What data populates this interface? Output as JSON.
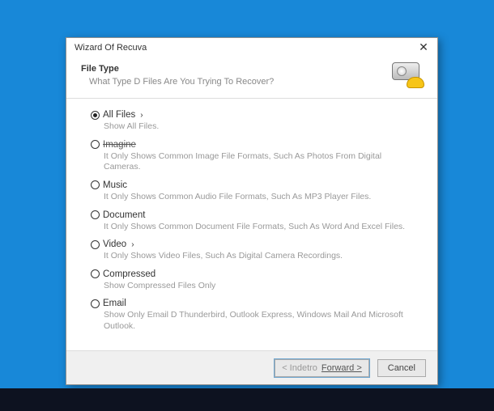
{
  "dialog": {
    "title": "Wizard Of Recuva",
    "header": {
      "title": "File Type",
      "subtitle": "What Type D Files Are You Trying To Recover?"
    },
    "options": [
      {
        "label": "All Files",
        "desc": "Show All Files.",
        "selected": true,
        "caret": true
      },
      {
        "label": "Imagine",
        "desc": "It Only Shows Common Image File Formats, Such As Photos From Digital Cameras.",
        "struck": true
      },
      {
        "label": "Music",
        "desc": "It Only Shows Common Audio File Formats, Such As MP3 Player Files."
      },
      {
        "label": "Document",
        "desc": "It Only Shows Common Document File Formats, Such As Word And Excel Files."
      },
      {
        "label": "Video",
        "desc": "It Only Shows Video Files, Such As Digital Camera Recordings.",
        "caret": true
      },
      {
        "label": "Compressed",
        "desc": "Show Compressed Files Only"
      },
      {
        "label": "Email",
        "desc": "Show Only Email D Thunderbird, Outlook Express, Windows Mail And Microsoft Outlook."
      }
    ],
    "footer": {
      "back": "< Indetro",
      "forward": "Forward >",
      "cancel": "Cancel"
    }
  }
}
